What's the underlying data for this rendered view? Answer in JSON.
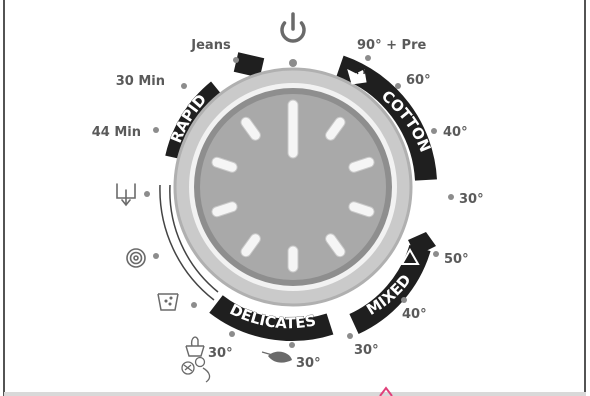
{
  "programs": {
    "jeans": "Jeans",
    "min30": "30 Min",
    "min44": "44 Min",
    "pre90": "90° + Pre",
    "cotton60": "60°",
    "cotton40": "40°",
    "cotton30": "30°",
    "mixed50": "50°",
    "mixed40": "40°",
    "mixed30": "30°",
    "wool30": "30°",
    "hand30": "30°"
  },
  "bands": {
    "rapid": "RAPID",
    "cotton": "COTTON",
    "mixed": "MIXED",
    "delicates": "DELICATES"
  },
  "icons": {
    "power": "power-icon",
    "drain": "drain-icon",
    "spin": "spin-icon",
    "rinse": "rinse-icon",
    "stain": "stain-icon",
    "easy_iron": "easy-iron-icon",
    "hand_wash": "hand-wash-icon",
    "wool": "wool-icon",
    "feather": "feather-icon"
  },
  "colors": {
    "panel_bg": "#ffffff",
    "label": "#5a5a5a",
    "band": "#1f1f1f",
    "dot": "#888888",
    "knob_outer": "#c9c9c9",
    "knob_face": "#a9a9a9",
    "accent": "#e0407a"
  }
}
